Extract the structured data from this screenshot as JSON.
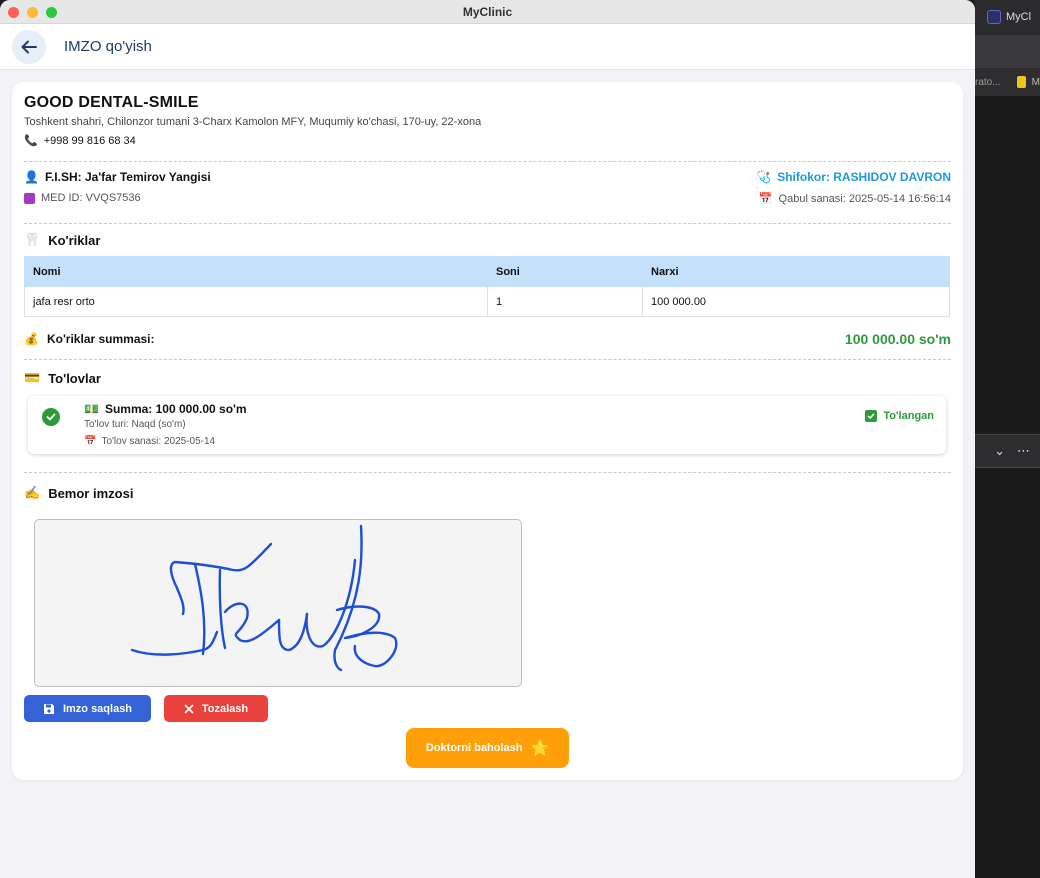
{
  "window": {
    "title": "MyClinic"
  },
  "background_app": {
    "tab_label": "MyCl",
    "row_text": "rato...",
    "row_text2": "M"
  },
  "header": {
    "title": "IMZO qo'yish"
  },
  "clinic": {
    "name": "GOOD DENTAL-SMILE",
    "address": "Toshkent shahri, Chilonzor tumani 3-Charx Kamolon MFY, Muqumiy ko'chasi, 170-uy, 22-xona",
    "phone": "+998 99 816 68 34"
  },
  "patient": {
    "fish": "F.I.SH: Ja'far Temirov Yangisi",
    "med_id": "MED ID: VVQS7536",
    "doctor": "Shifokor: RASHIDOV DAVRON",
    "date": "Qabul sanasi: 2025-05-14 16:56:14"
  },
  "services": {
    "title": "Ko'riklar",
    "columns": [
      "Nomi",
      "Soni",
      "Narxi"
    ],
    "rows": [
      [
        "jafa resr orto",
        "1",
        "100 000.00"
      ]
    ]
  },
  "summary": {
    "label": "Ko'riklar summasi:",
    "amount": "100 000.00 so'm"
  },
  "payments": {
    "title": "To'lovlar",
    "items": [
      {
        "summa": "Summa: 100 000.00 so'm",
        "type": "To'lov turi: Naqd (so'm)",
        "date": "To'lov sanasi: 2025-05-14",
        "status": "To'langan"
      }
    ]
  },
  "signature": {
    "title": "Bemor imzosi",
    "save_label": "Imzo saqlash",
    "clear_label": "Tozalash",
    "stroke_color": "#1d4fd6"
  },
  "rate": {
    "label": "Doktorni baholash"
  },
  "colors": {
    "accent_blue": "#3463d6",
    "danger": "#e9413b",
    "success": "#2e9b3a",
    "warning": "#ff9f0a",
    "doctor_link": "#1e9bd7",
    "table_header": "#c5e0fb"
  }
}
